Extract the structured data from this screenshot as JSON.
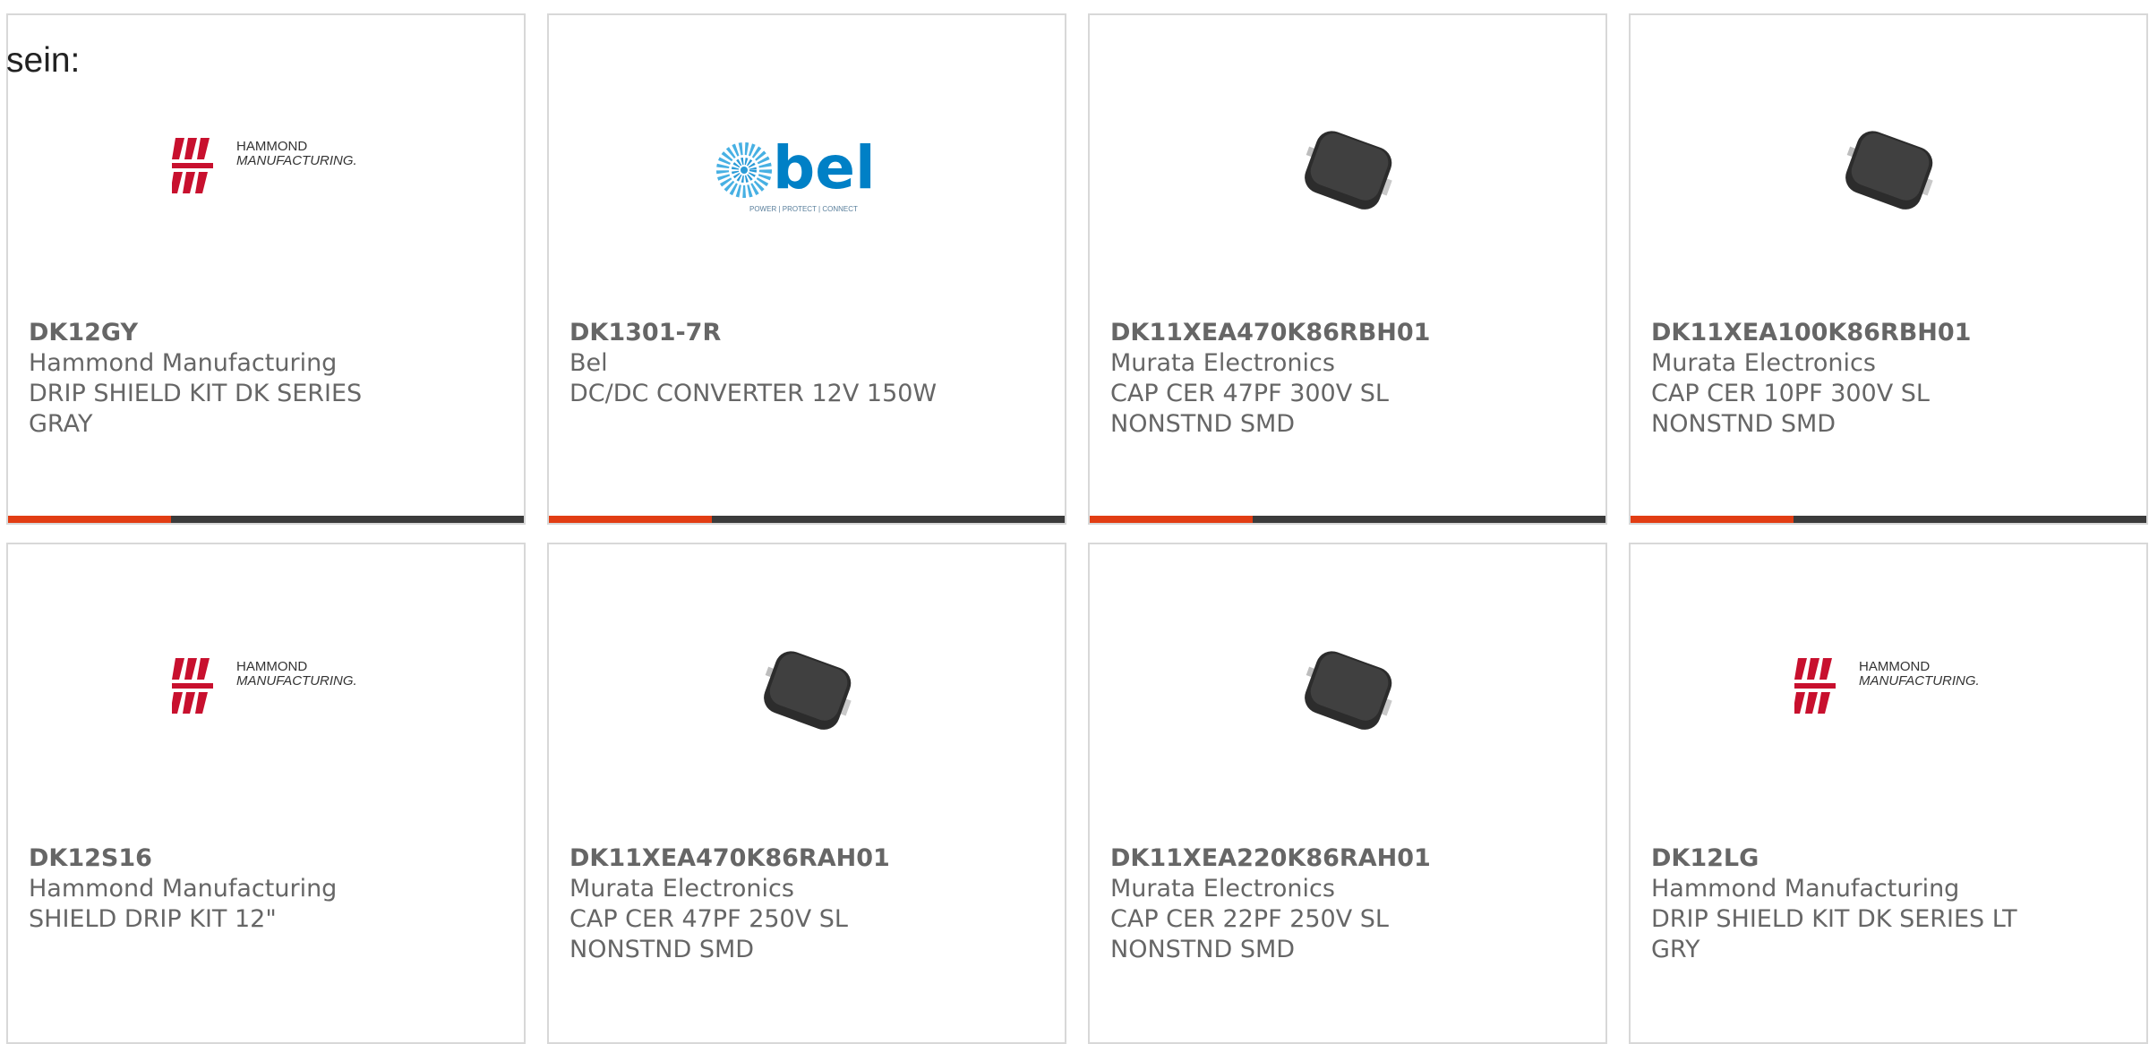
{
  "intro_label": "sein:",
  "brand_logos": {
    "hammond": {
      "line1": "HAMMOND",
      "line2": "MANUFACTURING."
    },
    "bel": {
      "word": "bel",
      "tagline": "POWER | PROTECT | CONNECT"
    }
  },
  "colors": {
    "accent": "#e23d13",
    "bar": "#3b3b3b",
    "text": "#666666",
    "hammond_red": "#c8102e",
    "bel_blue": "#0080c6"
  },
  "products": [
    {
      "part": "DK12GY",
      "manufacturer": "Hammond Manufacturing",
      "desc1": "DRIP SHIELD KIT DK SERIES",
      "desc2": "GRAY",
      "image": "hammond-logo"
    },
    {
      "part": "DK1301-7R",
      "manufacturer": "Bel",
      "desc1": "DC/DC CONVERTER 12V 150W",
      "desc2": "",
      "image": "bel-logo"
    },
    {
      "part": "DK11XEA470K86RBH01",
      "manufacturer": "Murata Electronics",
      "desc1": "CAP CER 47PF 300V SL",
      "desc2": "NONSTND SMD",
      "image": "smd-capacitor"
    },
    {
      "part": "DK11XEA100K86RBH01",
      "manufacturer": "Murata Electronics",
      "desc1": "CAP CER 10PF 300V SL",
      "desc2": "NONSTND SMD",
      "image": "smd-capacitor"
    },
    {
      "part": "DK12S16",
      "manufacturer": "Hammond Manufacturing",
      "desc1": "SHIELD DRIP KIT 12\"",
      "desc2": "",
      "image": "hammond-logo"
    },
    {
      "part": "DK11XEA470K86RAH01",
      "manufacturer": "Murata Electronics",
      "desc1": "CAP CER 47PF 250V SL",
      "desc2": "NONSTND SMD",
      "image": "smd-capacitor"
    },
    {
      "part": "DK11XEA220K86RAH01",
      "manufacturer": "Murata Electronics",
      "desc1": "CAP CER 22PF 250V SL",
      "desc2": "NONSTND SMD",
      "image": "smd-capacitor"
    },
    {
      "part": "DK12LG",
      "manufacturer": "Hammond Manufacturing",
      "desc1": "DRIP SHIELD KIT DK SERIES LT",
      "desc2": "GRY",
      "image": "hammond-logo"
    }
  ]
}
